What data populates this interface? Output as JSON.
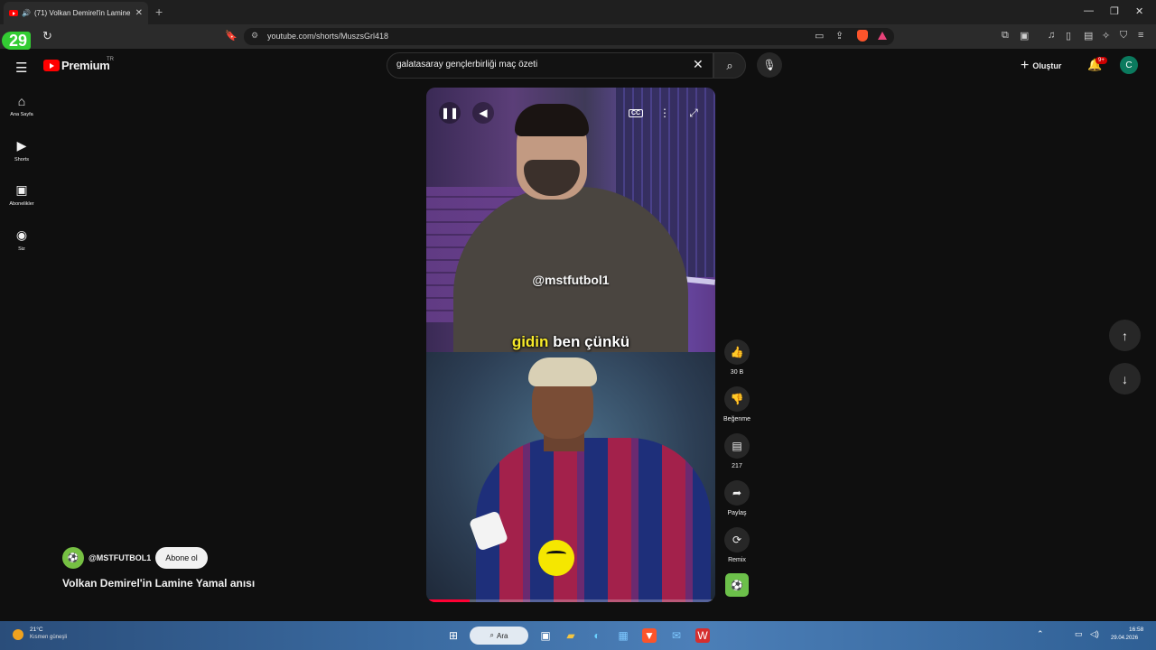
{
  "browser": {
    "tab_title": "(71) Volkan Demirel'in Lamine",
    "url": "youtube.com/shorts/MuszsGrl418",
    "badge_count": "29"
  },
  "header": {
    "logo_text": "Premium",
    "logo_region": "TR",
    "search_value": "galatasaray gençlerbirliği maç özeti",
    "create_label": "Oluştur",
    "notification_badge": "9+",
    "avatar_initial": "C"
  },
  "sidebar": {
    "items": [
      {
        "label": "Ana Sayfa",
        "icon": "home-icon"
      },
      {
        "label": "Shorts",
        "icon": "shorts-icon"
      },
      {
        "label": "Abonelikler",
        "icon": "subscriptions-icon"
      },
      {
        "label": "Siz",
        "icon": "you-icon"
      }
    ]
  },
  "video": {
    "watermark": "@mstfutbol1",
    "caption_highlight": "gidin",
    "caption_rest": "ben çünkü",
    "progress": 0.15
  },
  "actions": {
    "like_count": "30 B",
    "dislike_label": "Beğenme",
    "comment_count": "217",
    "share_label": "Paylaş",
    "remix_label": "Remix"
  },
  "channel": {
    "name": "@MSTFUTBOL1",
    "subscribe_label": "Abone ol",
    "video_title": "Volkan Demirel'in Lamine Yamal anısı"
  },
  "taskbar": {
    "temperature": "21°C",
    "weather_desc": "Kısmen güneşli",
    "search_label": "Ara",
    "time": "16:58",
    "date": "29.04.2026"
  },
  "colors": {
    "accent": "#ff0000",
    "background": "#0f0f0f",
    "caption_highlight": "#f7ea2a"
  }
}
